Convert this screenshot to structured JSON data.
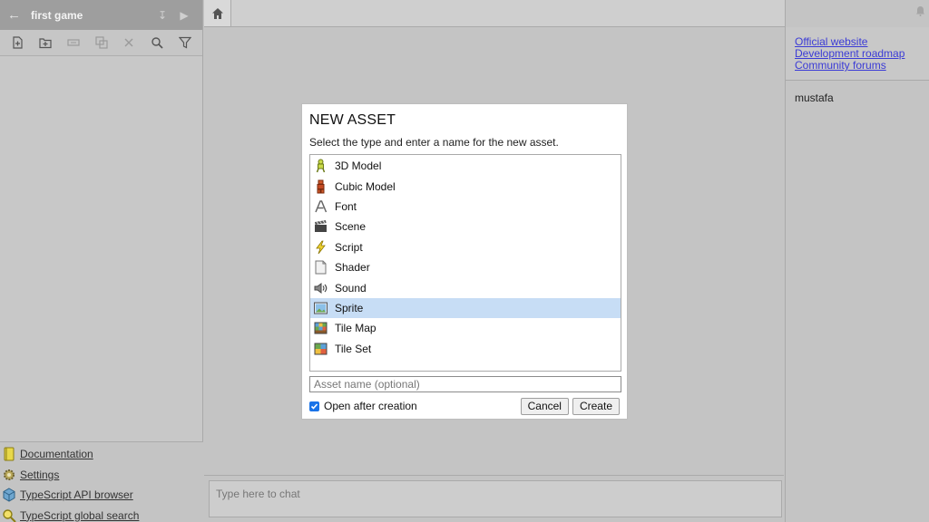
{
  "project": {
    "title": "first game"
  },
  "sidebar_links": [
    {
      "label": "Documentation",
      "icon": "book-icon"
    },
    {
      "label": "Settings",
      "icon": "gear-icon"
    },
    {
      "label": "TypeScript API browser",
      "icon": "cube-icon"
    },
    {
      "label": "TypeScript global search",
      "icon": "search-icon"
    }
  ],
  "chat": {
    "placeholder": "Type here to chat"
  },
  "right_panel": {
    "links": [
      "Official website",
      "Development roadmap",
      "Community forums"
    ],
    "username": "mustafa"
  },
  "modal": {
    "title": "NEW ASSET",
    "description": "Select the type and enter a name for the new asset.",
    "asset_types": [
      {
        "label": "3D Model",
        "icon": "3d-model-icon"
      },
      {
        "label": "Cubic Model",
        "icon": "cubic-model-icon"
      },
      {
        "label": "Font",
        "icon": "font-icon"
      },
      {
        "label": "Scene",
        "icon": "scene-icon"
      },
      {
        "label": "Script",
        "icon": "script-icon"
      },
      {
        "label": "Shader",
        "icon": "shader-icon"
      },
      {
        "label": "Sound",
        "icon": "sound-icon"
      },
      {
        "label": "Sprite",
        "icon": "sprite-icon",
        "selected": true
      },
      {
        "label": "Tile Map",
        "icon": "tile-map-icon"
      },
      {
        "label": "Tile Set",
        "icon": "tile-set-icon"
      }
    ],
    "name_placeholder": "Asset name (optional)",
    "open_after_label": "Open after creation",
    "open_after_checked": true,
    "cancel_label": "Cancel",
    "create_label": "Create"
  },
  "colors": {
    "selection": "#c7ddf5",
    "link": "#3b3bd6",
    "checkbox": "#1a73e8"
  }
}
